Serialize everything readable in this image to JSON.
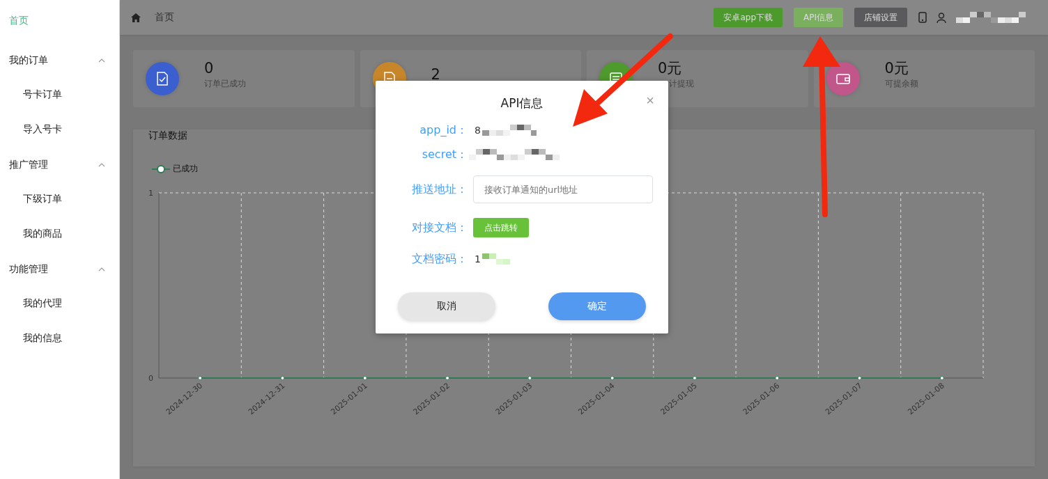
{
  "sidebar": {
    "items": [
      {
        "label": "首页",
        "kind": "link",
        "selected": true
      },
      {
        "label": "我的订单",
        "kind": "group",
        "expanded": true,
        "children": [
          {
            "label": "号卡订单",
            "selected": false
          },
          {
            "label": "导入号卡",
            "selected": false
          }
        ]
      },
      {
        "label": "推广管理",
        "kind": "group",
        "expanded": true,
        "children": [
          {
            "label": "下级订单",
            "selected": false
          },
          {
            "label": "我的商品",
            "selected": false
          }
        ]
      },
      {
        "label": "功能管理",
        "kind": "group",
        "expanded": true,
        "children": [
          {
            "label": "我的代理",
            "selected": false
          },
          {
            "label": "我的信息",
            "selected": false
          }
        ]
      }
    ]
  },
  "topbar": {
    "breadcrumb": "首页",
    "buttons": [
      {
        "label": "安卓app下载",
        "color": "#4d9a2c"
      },
      {
        "label": "API信息",
        "color": "#7aaf5e"
      },
      {
        "label": "店铺设置",
        "color": "#5a5a5c"
      }
    ]
  },
  "stats": [
    {
      "value": "0",
      "label": "订单已成功",
      "color": "#3b5fcf"
    },
    {
      "value": "2",
      "color": "#c8862a"
    },
    {
      "value": "0元",
      "label": "计提现",
      "color": "#4f9a2c"
    },
    {
      "value": "0元",
      "label": "可提余额",
      "color": "#c0568a"
    }
  ],
  "orders_chart": {
    "title": "订单数据",
    "chart_data": {
      "type": "line",
      "categories": [
        "2024-12-30",
        "2024-12-31",
        "2025-01-01",
        "2025-01-02",
        "2025-01-03",
        "2025-01-04",
        "2025-01-05",
        "2025-01-06",
        "2025-01-07",
        "2025-01-08"
      ],
      "series": [
        {
          "name": "已成功",
          "color": "#2f7a55",
          "marker": true,
          "values": [
            0,
            0,
            0,
            0,
            0,
            0,
            0,
            0,
            0,
            0
          ]
        }
      ],
      "ylim": [
        0,
        1
      ],
      "yticks": [
        0,
        1
      ]
    }
  },
  "dialog": {
    "title": "API信息",
    "close": "×",
    "fields": [
      {
        "kind": "text",
        "label": "app_id：",
        "value": "8"
      },
      {
        "kind": "text",
        "label": "secret："
      },
      {
        "kind": "input",
        "label": "推送地址：",
        "placeholder": "接收订单通知的url地址"
      },
      {
        "kind": "button",
        "label": "对接文档：",
        "value": "点击跳转"
      },
      {
        "kind": "text",
        "label": "文档密码：",
        "value": "1"
      }
    ],
    "cancel": "取消",
    "confirm": "确定"
  }
}
